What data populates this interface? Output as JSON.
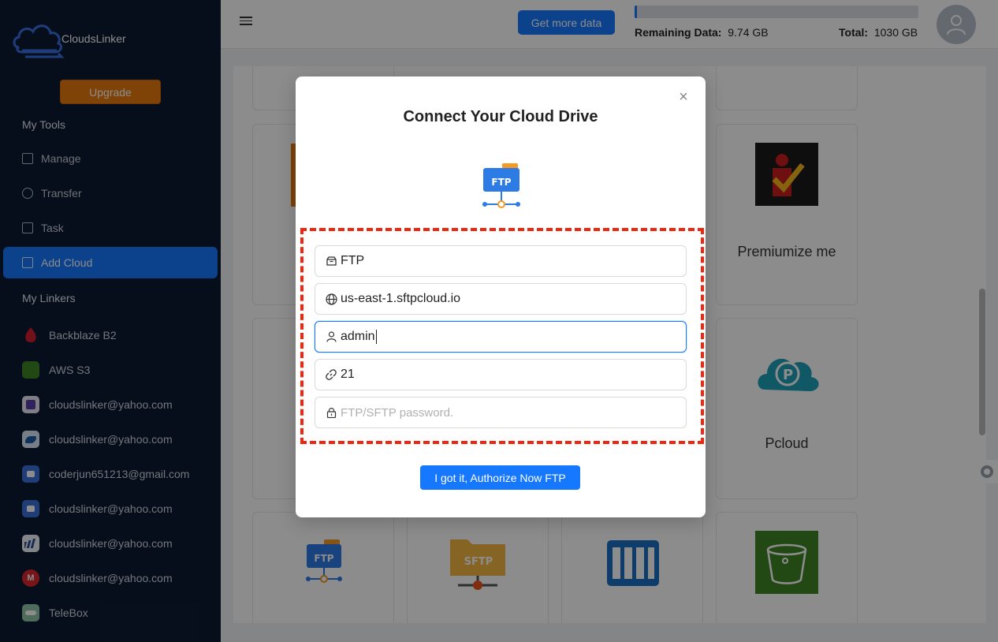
{
  "app": {
    "name": "CloudsLinker",
    "upgrade_label": "Upgrade"
  },
  "sidebar": {
    "my_tools_title": "My Tools",
    "tools": [
      {
        "label": "Manage",
        "icon": "grid-icon"
      },
      {
        "label": "Transfer",
        "icon": "cloud-upload-icon"
      },
      {
        "label": "Task",
        "icon": "calendar-icon"
      },
      {
        "label": "Add Cloud",
        "icon": "add-cloud-icon",
        "active": true
      }
    ],
    "my_linkers_title": "My Linkers",
    "linkers": [
      {
        "label": "Backblaze B2",
        "icon": "backblaze-icon",
        "color": "#d4202c"
      },
      {
        "label": "AWS S3",
        "icon": "aws-s3-icon",
        "color": "#3f8624"
      },
      {
        "label": "cloudslinker@yahoo.com",
        "icon": "yahoo-icon",
        "color": "#5b3ea6"
      },
      {
        "label": "cloudslinker@yahoo.com",
        "icon": "eagle-icon",
        "color": "#1e5aa8"
      },
      {
        "label": "coderjun651213@gmail.com",
        "icon": "robot-icon",
        "color": "#3a6fd8"
      },
      {
        "label": "cloudslinker@yahoo.com",
        "icon": "robot-icon",
        "color": "#3a6fd8"
      },
      {
        "label": "cloudslinker@yahoo.com",
        "icon": "bars-icon",
        "color": "#2a4d9b"
      },
      {
        "label": "cloudslinker@yahoo.com",
        "icon": "mega-icon",
        "color": "#d9272e"
      },
      {
        "label": "TeleBox",
        "icon": "telebox-icon",
        "color": "#4a9a7a"
      }
    ]
  },
  "header": {
    "get_more_label": "Get more data",
    "remaining_label": "Remaining Data:",
    "remaining_value": "9.74 GB",
    "total_label": "Total:",
    "total_value": "1030 GB",
    "usage_fraction": 0.009
  },
  "cards": {
    "premiumize_label": "Premiumize me",
    "pcloud_label": "Pcloud",
    "ftp_badge": "FTP",
    "sftp_badge": "SFTP"
  },
  "modal": {
    "title": "Connect Your Cloud Drive",
    "icon_badge": "FTP",
    "fields": [
      {
        "name": "type-field",
        "icon": "box-icon",
        "value": "FTP"
      },
      {
        "name": "host-field",
        "icon": "globe-icon",
        "value": "us-east-1.sftpcloud.io"
      },
      {
        "name": "username-field",
        "icon": "user-icon",
        "value": "admin"
      },
      {
        "name": "port-field",
        "icon": "link-icon",
        "value": "21"
      },
      {
        "name": "password-field",
        "icon": "lock-icon",
        "value": "",
        "placeholder": "FTP/SFTP password."
      }
    ],
    "authorize_label": "I got it, Authorize Now FTP"
  }
}
